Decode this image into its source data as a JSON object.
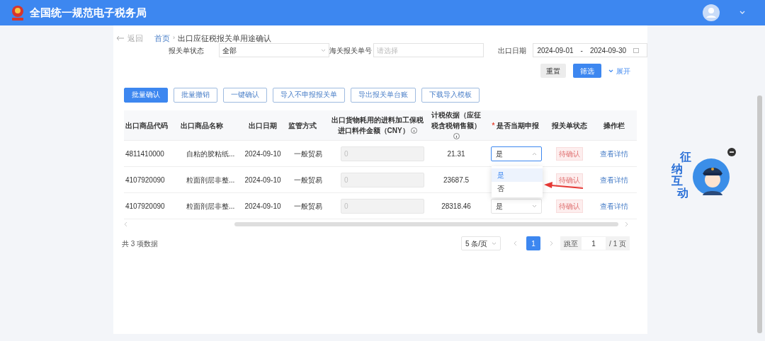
{
  "header": {
    "title": "全国统一规范电子税务局"
  },
  "breadcrumb": {
    "back": "返回",
    "home": "首页",
    "separator": "›",
    "current": "出口应征税报关单用途确认"
  },
  "filters": [
    {
      "kind": "select",
      "label": "报关单状态",
      "value": "全部"
    },
    {
      "kind": "input",
      "label": "海关报关单号",
      "placeholder": "请选择"
    },
    {
      "kind": "daterange",
      "label": "出口日期",
      "start": "2024-09-01",
      "separator": "-",
      "end": "2024-09-30"
    }
  ],
  "filter_actions": {
    "reset": "重置",
    "submit": "筛选",
    "expand": "展开"
  },
  "toolbar": [
    {
      "label": "批量确认",
      "primary": true
    },
    {
      "label": "批量撤销",
      "primary": false
    },
    {
      "label": "一键确认",
      "primary": false
    },
    {
      "label": "导入不申报报关单",
      "primary": false
    },
    {
      "label": "导出报关单台账",
      "primary": false
    },
    {
      "label": "下载导入模板",
      "primary": false
    }
  ],
  "table": {
    "columns": [
      {
        "label": "出口商品代码",
        "info": false
      },
      {
        "label": "出口商品名称",
        "info": false
      },
      {
        "label": "出口日期",
        "info": false
      },
      {
        "label": "监管方式",
        "info": false
      },
      {
        "label": "出口货物耗用的进料加工保税进口料件金额（CNY）",
        "info": true
      },
      {
        "label": "计税依据（应征税含税销售额）",
        "info": true
      },
      {
        "label": "是否当期申报",
        "required_mark": "*",
        "info": false
      },
      {
        "label": "报关单状态",
        "info": false
      },
      {
        "label": "操作栏",
        "info": false
      }
    ],
    "rows": [
      {
        "code": "4811410000",
        "name": "自粘的胶粘纸...",
        "date": "2024-09-10",
        "method": "一般贸易",
        "bonded_amount": "0",
        "tax_basis": "21.31",
        "declare": "是",
        "expanded": true,
        "status": "待确认",
        "action": "查看详情"
      },
      {
        "code": "4107920090",
        "name": "粒面剖层非整...",
        "date": "2024-09-10",
        "method": "一般贸易",
        "bonded_amount": "0",
        "tax_basis": "23687.5",
        "status": "待确认",
        "action": "查看详情"
      },
      {
        "code": "4107920090",
        "name": "粒面剖层非整...",
        "date": "2024-09-10",
        "method": "一般贸易",
        "bonded_amount": "0",
        "tax_basis": "28318.46",
        "declare": "是",
        "expanded": false,
        "status": "待确认",
        "action": "查看详情"
      }
    ]
  },
  "dropdown": {
    "options": [
      {
        "label": "是",
        "selected": true
      },
      {
        "label": "否",
        "selected": false
      }
    ]
  },
  "pagination": {
    "total": "共 3 项数据",
    "page_size": "5 条/页",
    "pages": [
      {
        "label": "1",
        "selected": true
      }
    ],
    "jump_label": "跳至",
    "jump_value": "1",
    "total_pages": "/ 1 页"
  },
  "assistant": {
    "text": "征纳互动"
  }
}
